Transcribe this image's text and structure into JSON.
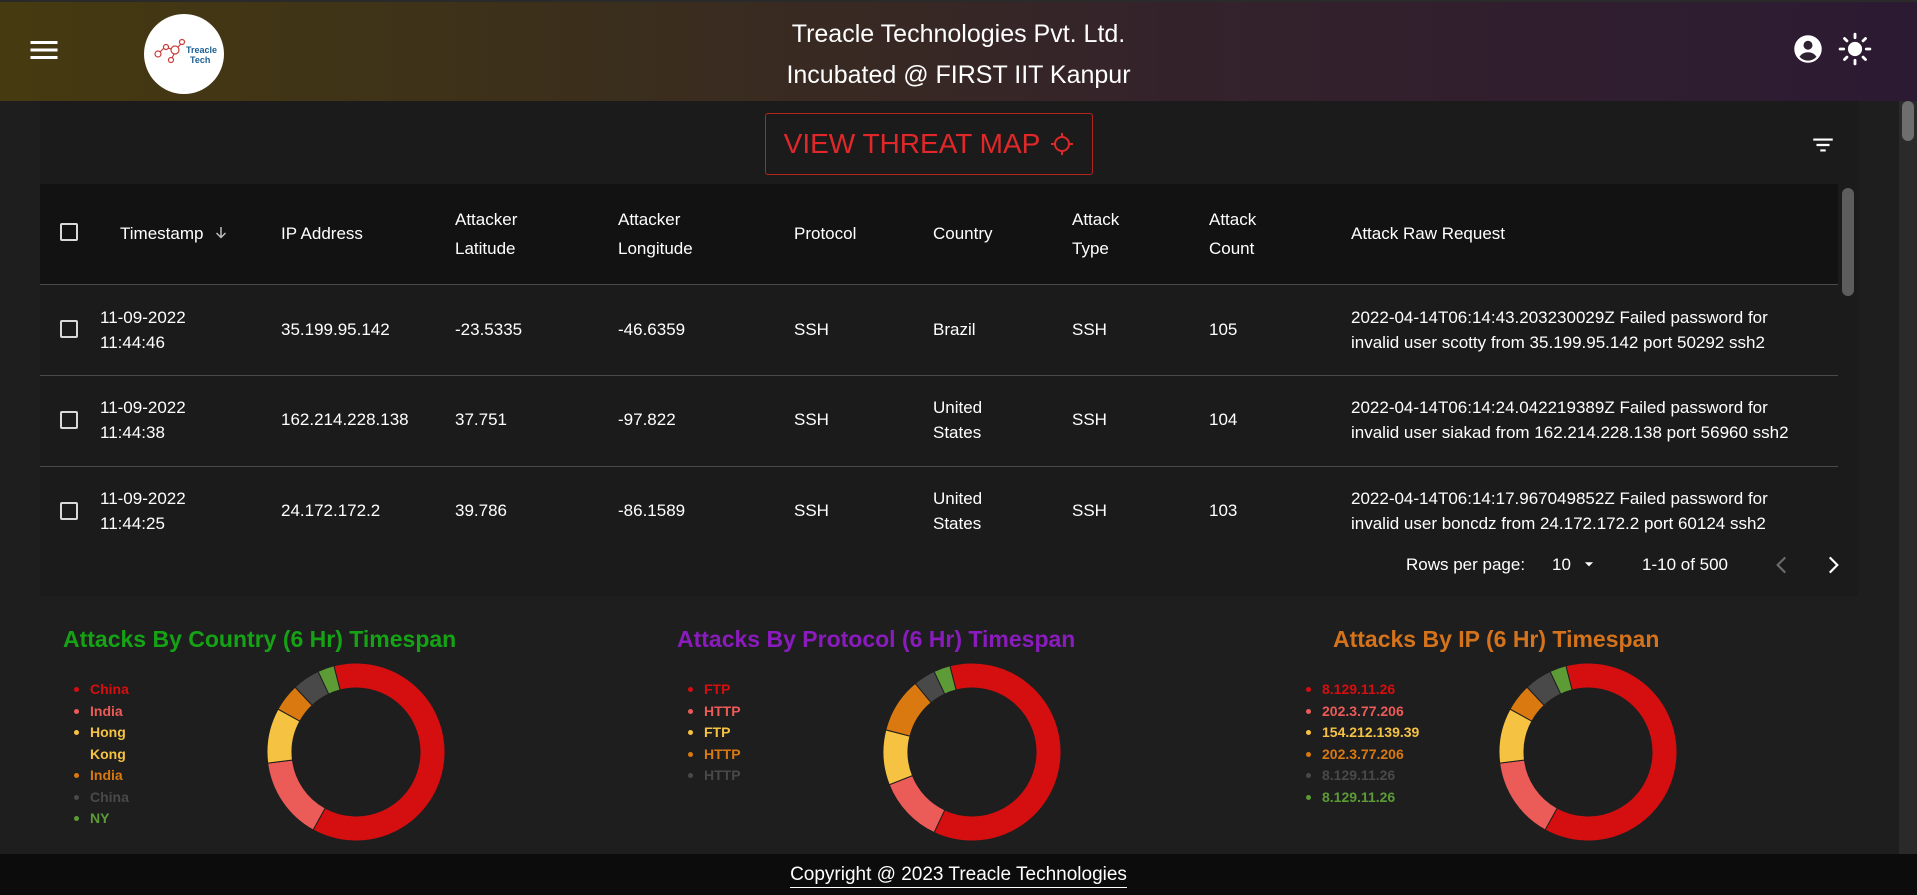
{
  "header": {
    "company": "Treacle Technologies Pvt. Ltd.",
    "incubation": "Incubated @ FIRST IIT Kanpur",
    "logo_text_line1": "Treacle",
    "logo_text_line2": "Tech"
  },
  "toolbar": {
    "threat_map_label": "VIEW THREAT MAP"
  },
  "table": {
    "columns": [
      "Timestamp",
      "IP Address",
      "Attacker",
      "Latitude",
      "Attacker",
      "Longitude",
      "Protocol",
      "Country",
      "Attack",
      "Type",
      "Attack",
      "Count",
      "Attack Raw Request"
    ],
    "headers": {
      "timestamp": "Timestamp",
      "ip": "IP Address",
      "lat1": "Attacker",
      "lat2": "Latitude",
      "lon1": "Attacker",
      "lon2": "Longitude",
      "protocol": "Protocol",
      "country": "Country",
      "type1": "Attack",
      "type2": "Type",
      "count1": "Attack",
      "count2": "Count",
      "raw": "Attack Raw Request"
    },
    "rows": [
      {
        "date": "11-09-2022",
        "time": "11:44:46",
        "ip": "35.199.95.142",
        "lat": "-23.5335",
        "lon": "-46.6359",
        "protocol": "SSH",
        "country1": "Brazil",
        "country2": "",
        "type": "SSH",
        "count": "105",
        "raw1": "2022-04-14T06:14:43.203230029Z Failed password for",
        "raw2": "invalid user scotty from 35.199.95.142 port 50292 ssh2"
      },
      {
        "date": "11-09-2022",
        "time": "11:44:38",
        "ip": "162.214.228.138",
        "lat": "37.751",
        "lon": "-97.822",
        "protocol": "SSH",
        "country1": "United",
        "country2": "States",
        "type": "SSH",
        "count": "104",
        "raw1": "2022-04-14T06:14:24.042219389Z Failed password for",
        "raw2": "invalid user siakad from 162.214.228.138 port 56960 ssh2"
      },
      {
        "date": "11-09-2022",
        "time": "11:44:25",
        "ip": "24.172.172.2",
        "lat": "39.786",
        "lon": "-86.1589",
        "protocol": "SSH",
        "country1": "United",
        "country2": "States",
        "type": "SSH",
        "count": "103",
        "raw1": "2022-04-14T06:14:17.967049852Z Failed password for",
        "raw2": "invalid user boncdz from 24.172.172.2 port 60124 ssh2"
      }
    ]
  },
  "pagination": {
    "rows_per_page_label": "Rows per page:",
    "rows_per_page_value": "10",
    "range": "1-10 of 500"
  },
  "charts": {
    "country": {
      "title": "Attacks By Country (6 Hr) Timespan",
      "title_color": "#15a315",
      "legend": [
        "China",
        "India",
        "Hong",
        "Kong",
        "India",
        "China",
        "NY"
      ]
    },
    "protocol": {
      "title": "Attacks By Protocol (6 Hr) Timespan",
      "title_color": "#8a1bbd",
      "legend": [
        "FTP",
        "HTTP",
        "FTP",
        "HTTP",
        "HTTP"
      ]
    },
    "ip": {
      "title": "Attacks By IP (6 Hr) Timespan",
      "title_color": "#d4731c",
      "legend": [
        "8.129.11.26",
        "202.3.77.206",
        "154.212.139.39",
        "202.3.77.206",
        "8.129.11.26",
        "8.129.11.26"
      ]
    }
  },
  "chart_data": [
    {
      "type": "pie",
      "title": "Attacks By Country (6 Hr) Timespan",
      "categories": [
        "China",
        "India",
        "Hong Kong",
        "India",
        "China",
        "NY"
      ],
      "values": [
        62,
        15,
        10,
        5,
        5,
        3
      ],
      "colors": [
        "#d50f0f",
        "#eb5b57",
        "#f5c242",
        "#d97910",
        "#494949",
        "#5c9b35"
      ]
    },
    {
      "type": "pie",
      "title": "Attacks By Protocol (6 Hr) Timespan",
      "categories": [
        "FTP",
        "HTTP",
        "FTP",
        "HTTP",
        "HTTP"
      ],
      "values": [
        61,
        12,
        10,
        10,
        4,
        3
      ],
      "colors": [
        "#d50f0f",
        "#eb5b57",
        "#f5c242",
        "#d97910",
        "#494949",
        "#5c9b35"
      ]
    },
    {
      "type": "pie",
      "title": "Attacks By IP (6 Hr) Timespan",
      "categories": [
        "8.129.11.26",
        "202.3.77.206",
        "154.212.139.39",
        "202.3.77.206",
        "8.129.11.26",
        "8.129.11.26"
      ],
      "values": [
        62,
        15,
        10,
        5,
        5,
        3
      ],
      "colors": [
        "#d50f0f",
        "#eb5b57",
        "#f5c242",
        "#d97910",
        "#494949",
        "#5c9b35"
      ]
    }
  ],
  "legend_colors": [
    "#d50f0f",
    "#eb5b57",
    "#f5c242",
    "#d97910",
    "#494949",
    "#5c9b35"
  ],
  "footer": {
    "copyright": "Copyright @ 2023 Treacle Technologies"
  }
}
